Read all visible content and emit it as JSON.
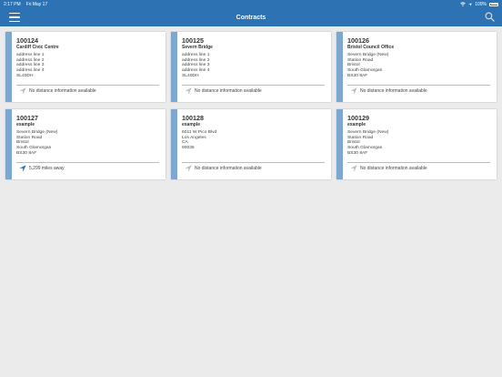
{
  "status": {
    "time": "2:17 PM",
    "date": "Fri May 17",
    "battery": "100%"
  },
  "nav": {
    "title": "Contracts"
  },
  "colors": {
    "primary": "#2d73b4",
    "stripe": "#7fa6cf",
    "located_icon": "#2d73b4",
    "no_location_icon": "#bdbdbd"
  },
  "contracts": [
    {
      "number": "100124",
      "name": "Cardiff Civic Centre",
      "address": [
        "address line 1",
        "address line 2",
        "address line 3",
        "address line 4",
        "SL40DH"
      ],
      "distance": "No distance information available",
      "has_distance": false
    },
    {
      "number": "100125",
      "name": "Severn Bridge",
      "address": [
        "address line 1",
        "address line 2",
        "address line 3",
        "address line 4",
        "SL40DH"
      ],
      "distance": "No distance information available",
      "has_distance": false
    },
    {
      "number": "100126",
      "name": "Bristol Council Office",
      "address": [
        "Severn Bridge (New)",
        "Station Road",
        "Bristol",
        "South Glamorgan",
        "BS30 8AF"
      ],
      "distance": "No distance information available",
      "has_distance": false
    },
    {
      "number": "100127",
      "name": "example",
      "address": [
        "Severn Bridge (New)",
        "Station Road",
        "Bristol",
        "South Glamorgan",
        "BS30 8AF"
      ],
      "distance": "5,299 miles away",
      "has_distance": true
    },
    {
      "number": "100128",
      "name": "example",
      "address": [
        "6011 W Pico Blvd",
        "Los Angeles",
        "CA",
        "90035"
      ],
      "distance": "No distance information available",
      "has_distance": false
    },
    {
      "number": "100129",
      "name": "example",
      "address": [
        "Severn Bridge (New)",
        "Station Road",
        "Bristol",
        "South Glamorgan",
        "BS30 8AF"
      ],
      "distance": "No distance information available",
      "has_distance": false
    }
  ]
}
